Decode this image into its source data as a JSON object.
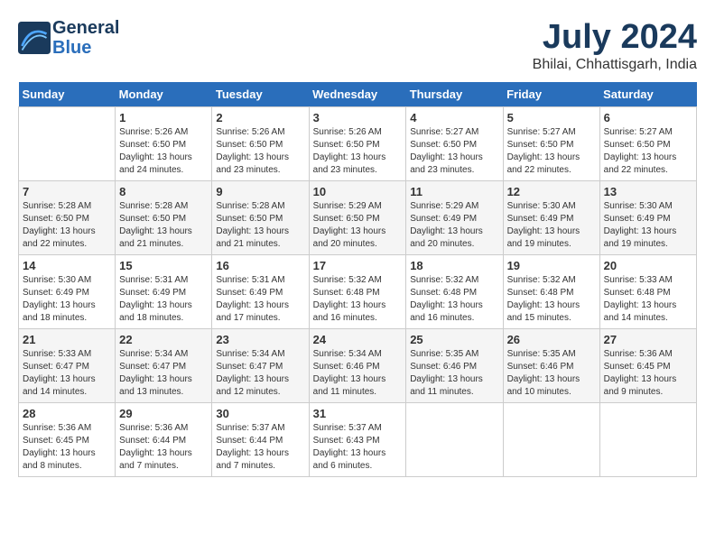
{
  "header": {
    "logo_line1": "General",
    "logo_line2": "Blue",
    "month": "July 2024",
    "location": "Bhilai, Chhattisgarh, India"
  },
  "weekdays": [
    "Sunday",
    "Monday",
    "Tuesday",
    "Wednesday",
    "Thursday",
    "Friday",
    "Saturday"
  ],
  "weeks": [
    [
      {
        "day": "",
        "info": ""
      },
      {
        "day": "1",
        "info": "Sunrise: 5:26 AM\nSunset: 6:50 PM\nDaylight: 13 hours\nand 24 minutes."
      },
      {
        "day": "2",
        "info": "Sunrise: 5:26 AM\nSunset: 6:50 PM\nDaylight: 13 hours\nand 23 minutes."
      },
      {
        "day": "3",
        "info": "Sunrise: 5:26 AM\nSunset: 6:50 PM\nDaylight: 13 hours\nand 23 minutes."
      },
      {
        "day": "4",
        "info": "Sunrise: 5:27 AM\nSunset: 6:50 PM\nDaylight: 13 hours\nand 23 minutes."
      },
      {
        "day": "5",
        "info": "Sunrise: 5:27 AM\nSunset: 6:50 PM\nDaylight: 13 hours\nand 22 minutes."
      },
      {
        "day": "6",
        "info": "Sunrise: 5:27 AM\nSunset: 6:50 PM\nDaylight: 13 hours\nand 22 minutes."
      }
    ],
    [
      {
        "day": "7",
        "info": "Sunrise: 5:28 AM\nSunset: 6:50 PM\nDaylight: 13 hours\nand 22 minutes."
      },
      {
        "day": "8",
        "info": "Sunrise: 5:28 AM\nSunset: 6:50 PM\nDaylight: 13 hours\nand 21 minutes."
      },
      {
        "day": "9",
        "info": "Sunrise: 5:28 AM\nSunset: 6:50 PM\nDaylight: 13 hours\nand 21 minutes."
      },
      {
        "day": "10",
        "info": "Sunrise: 5:29 AM\nSunset: 6:50 PM\nDaylight: 13 hours\nand 20 minutes."
      },
      {
        "day": "11",
        "info": "Sunrise: 5:29 AM\nSunset: 6:49 PM\nDaylight: 13 hours\nand 20 minutes."
      },
      {
        "day": "12",
        "info": "Sunrise: 5:30 AM\nSunset: 6:49 PM\nDaylight: 13 hours\nand 19 minutes."
      },
      {
        "day": "13",
        "info": "Sunrise: 5:30 AM\nSunset: 6:49 PM\nDaylight: 13 hours\nand 19 minutes."
      }
    ],
    [
      {
        "day": "14",
        "info": "Sunrise: 5:30 AM\nSunset: 6:49 PM\nDaylight: 13 hours\nand 18 minutes."
      },
      {
        "day": "15",
        "info": "Sunrise: 5:31 AM\nSunset: 6:49 PM\nDaylight: 13 hours\nand 18 minutes."
      },
      {
        "day": "16",
        "info": "Sunrise: 5:31 AM\nSunset: 6:49 PM\nDaylight: 13 hours\nand 17 minutes."
      },
      {
        "day": "17",
        "info": "Sunrise: 5:32 AM\nSunset: 6:48 PM\nDaylight: 13 hours\nand 16 minutes."
      },
      {
        "day": "18",
        "info": "Sunrise: 5:32 AM\nSunset: 6:48 PM\nDaylight: 13 hours\nand 16 minutes."
      },
      {
        "day": "19",
        "info": "Sunrise: 5:32 AM\nSunset: 6:48 PM\nDaylight: 13 hours\nand 15 minutes."
      },
      {
        "day": "20",
        "info": "Sunrise: 5:33 AM\nSunset: 6:48 PM\nDaylight: 13 hours\nand 14 minutes."
      }
    ],
    [
      {
        "day": "21",
        "info": "Sunrise: 5:33 AM\nSunset: 6:47 PM\nDaylight: 13 hours\nand 14 minutes."
      },
      {
        "day": "22",
        "info": "Sunrise: 5:34 AM\nSunset: 6:47 PM\nDaylight: 13 hours\nand 13 minutes."
      },
      {
        "day": "23",
        "info": "Sunrise: 5:34 AM\nSunset: 6:47 PM\nDaylight: 13 hours\nand 12 minutes."
      },
      {
        "day": "24",
        "info": "Sunrise: 5:34 AM\nSunset: 6:46 PM\nDaylight: 13 hours\nand 11 minutes."
      },
      {
        "day": "25",
        "info": "Sunrise: 5:35 AM\nSunset: 6:46 PM\nDaylight: 13 hours\nand 11 minutes."
      },
      {
        "day": "26",
        "info": "Sunrise: 5:35 AM\nSunset: 6:46 PM\nDaylight: 13 hours\nand 10 minutes."
      },
      {
        "day": "27",
        "info": "Sunrise: 5:36 AM\nSunset: 6:45 PM\nDaylight: 13 hours\nand 9 minutes."
      }
    ],
    [
      {
        "day": "28",
        "info": "Sunrise: 5:36 AM\nSunset: 6:45 PM\nDaylight: 13 hours\nand 8 minutes."
      },
      {
        "day": "29",
        "info": "Sunrise: 5:36 AM\nSunset: 6:44 PM\nDaylight: 13 hours\nand 7 minutes."
      },
      {
        "day": "30",
        "info": "Sunrise: 5:37 AM\nSunset: 6:44 PM\nDaylight: 13 hours\nand 7 minutes."
      },
      {
        "day": "31",
        "info": "Sunrise: 5:37 AM\nSunset: 6:43 PM\nDaylight: 13 hours\nand 6 minutes."
      },
      {
        "day": "",
        "info": ""
      },
      {
        "day": "",
        "info": ""
      },
      {
        "day": "",
        "info": ""
      }
    ]
  ]
}
